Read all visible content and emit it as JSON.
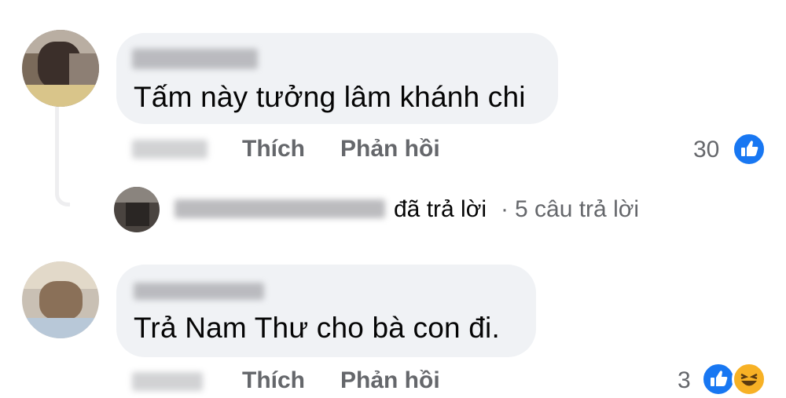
{
  "comments": [
    {
      "text": "Tấm này tưởng lâm khánh chi",
      "like_label": "Thích",
      "reply_label": "Phản hồi",
      "reaction_count": "30",
      "reactions": [
        "like-icon"
      ]
    },
    {
      "text": "Trả Nam Thư cho bà con đi.",
      "like_label": "Thích",
      "reply_label": "Phản hồi",
      "reaction_count": "3",
      "reactions": [
        "like-icon",
        "haha-icon"
      ]
    }
  ],
  "reply_summary": {
    "replied_text": "đã trả lời",
    "separator": "·",
    "count_text": "5 câu trả lời"
  },
  "colors": {
    "bubble": "#f0f2f5",
    "meta_text": "#65676b",
    "like_blue": "#1877f2",
    "haha_yellow": "#f7b125"
  }
}
